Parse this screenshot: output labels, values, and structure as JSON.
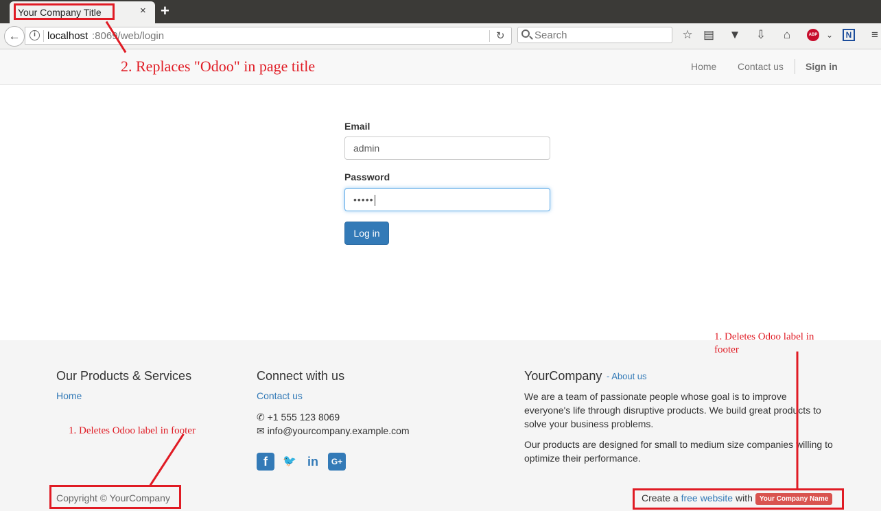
{
  "browser": {
    "tab_title": "Your Company Title",
    "tab_close": "×",
    "new_tab": "+",
    "url_host": "localhost",
    "url_path": ":8069/web/login",
    "search_placeholder": "Search"
  },
  "header": {
    "menu": [
      "Home",
      "Contact us"
    ],
    "sign_in": "Sign in"
  },
  "login_form": {
    "email_label": "Email",
    "email_value": "admin",
    "password_label": "Password",
    "password_value": "•••••",
    "login_button": "Log in"
  },
  "footer": {
    "products": {
      "heading": "Our Products & Services",
      "link": "Home"
    },
    "connect": {
      "heading": "Connect with us",
      "link": "Contact us",
      "phone": "+1 555 123 8069",
      "email": "info@yourcompany.example.com"
    },
    "company": {
      "name": "YourCompany",
      "about_link": "- About us",
      "paragraph1": "We are a team of passionate people whose goal is to improve everyone's life through disruptive products. We build great products to solve your business problems.",
      "paragraph2": "Our products are designed for small to medium size companies willing to optimize their performance."
    },
    "copyright": "Copyright © YourCompany",
    "powered_prefix": "Create a",
    "powered_link": "free website",
    "powered_with": "with",
    "company_badge": "Your Company Name"
  },
  "annotations": {
    "title_note": "2. Replaces \"Odoo\" in page title",
    "footer_note_left": "1. Deletes Odoo label in footer",
    "footer_note_right": "1. Deletes Odoo label in footer"
  },
  "colors": {
    "annotation_red": "#e01b24",
    "link_blue": "#337ab7",
    "button_blue": "#337ab7",
    "badge_red": "#d9534f"
  }
}
